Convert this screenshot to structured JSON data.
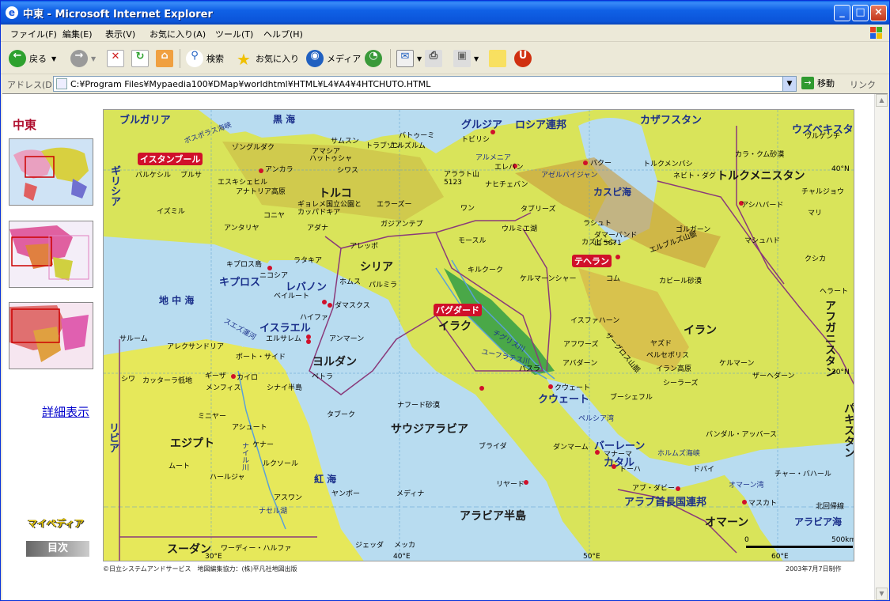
{
  "window": {
    "title": "中東 - Microsoft Internet Explorer",
    "minimize": "_",
    "maximize": "□",
    "close": "×"
  },
  "menu": [
    "ファイル(F)",
    "編集(E)",
    "表示(V)",
    "お気に入り(A)",
    "ツール(T)",
    "ヘルプ(H)"
  ],
  "toolbar": {
    "back": "戻る",
    "search": "検索",
    "favorites": "お気に入り",
    "media": "メディア"
  },
  "address": {
    "label": "アドレス(D)",
    "url": "C:¥Program Files¥Mypaedia100¥DMap¥worldhtml¥HTML¥L4¥A4¥4HTCHUTO.HTML",
    "go": "移動",
    "links": "リンク"
  },
  "sidebar": {
    "title": "中東",
    "detail_link": "詳細表示",
    "logo": "マイペディア",
    "toc": "目次"
  },
  "map": {
    "countries": [
      "トルコ",
      "シリア",
      "イラク",
      "イラン",
      "サウジアラビア",
      "エジプト",
      "ヨルダン",
      "クウェート",
      "バーレーン",
      "カタル",
      "アラブ首長国連邦",
      "オマーン",
      "トルクメニスタン",
      "アフガニスタン",
      "パキスタン",
      "ウズベキスタン",
      "カザフスタン",
      "ロシア連邦",
      "グルジア",
      "アルメニア",
      "アゼルバイジャン",
      "スーダン",
      "リビア",
      "ギリシア",
      "ブルガリア",
      "キプロス",
      "レバノン",
      "イスラエル"
    ],
    "seas": [
      "黒 海",
      "カスピ海",
      "地 中 海",
      "紅 海",
      "ペルシア湾",
      "オマーン湾",
      "アラビア海",
      "ボスポラス海峡",
      "ホルムズ海峡",
      "スエズ運河"
    ],
    "capitals": [
      "イスタンブール",
      "テヘラン",
      "バグダード"
    ],
    "cities": [
      "アンカラ",
      "ゾングルダク",
      "サムスン",
      "トラブゾン",
      "バトゥーミ",
      "トビリシ",
      "バクー",
      "エレバン",
      "ブルサ",
      "バルケシル",
      "イズミル",
      "アンタリヤ",
      "コニヤ",
      "アダナ",
      "アレッポ",
      "ホムス",
      "ダマスクス",
      "ベイルート",
      "ハイファ",
      "アンマーン",
      "エルサレム",
      "カイロ",
      "ギーザ",
      "アレクサンドリア",
      "ポート・サイド",
      "アシュート",
      "ルクソール",
      "アスワン",
      "メディナ",
      "メッカ",
      "ジェッダ",
      "リヤード",
      "ダンマーム",
      "ドーハ",
      "マナーマ",
      "アブ・ダビー",
      "ドバイ",
      "マスカト",
      "クウェート",
      "バスラ",
      "モースル",
      "キルクーク",
      "タブリーズ",
      "イスファハーン",
      "シーラーズ",
      "ケルマーン",
      "マシュハド",
      "ヘラート",
      "アシハバード",
      "ラシュト",
      "コム",
      "ヤズド",
      "アフワーズ",
      "アバダーン",
      "ブーシェフル",
      "ザーヘダーン",
      "ニコシア",
      "キプロス島",
      "ラタキア",
      "タブーク",
      "ブライダ",
      "ヤンボー",
      "ペトラ",
      "シワ",
      "ムート",
      "ハールジャ",
      "ミニヤー",
      "ケナー",
      "カラ・クム砂漠",
      "ネビト・ダグ",
      "トルクメンバシ",
      "チャルジョウ",
      "マリ",
      "クシカ",
      "バンダル・アッバース",
      "チャー・バハール",
      "ウルゲンチ",
      "ガジアンテプ",
      "エラーズー",
      "エルズルム",
      "シワス",
      "アマシア",
      "ハットゥシャ",
      "エスキシェヒル",
      "ナヒチェバン",
      "ワン",
      "ウルミエ湖",
      "ゴルガーン",
      "カズビーン",
      "ケルマーンシャー"
    ],
    "features": [
      "アナトリア高原",
      "ギョレメ国立公園とカッパドキア",
      "アララト山 5123",
      "ダマーバンド山 5671",
      "エルブルズ山脈",
      "ザーグロス山脈",
      "カビール砂漠",
      "イラン高原",
      "ペルセポリス",
      "ナフード砂漠",
      "シナイ半島",
      "カッターラ低地",
      "アラビア半島",
      "チグリス川",
      "ユーフラテス川",
      "ナイル川",
      "ナセル湖",
      "ワーディー・ハルファ",
      "パルミラ",
      "メンフィス",
      "サルーム",
      "北回帰線"
    ],
    "lon_labels": [
      "30°E",
      "40°E",
      "50°E",
      "60°E"
    ],
    "lat_labels": [
      "40°N",
      "30°N"
    ],
    "scale": [
      "0",
      "500km"
    ]
  },
  "caption": {
    "left": "©日立システムアンドサービス　地図編集協力：(株)平凡社地図出版",
    "right": "2003年7月7日制作"
  }
}
